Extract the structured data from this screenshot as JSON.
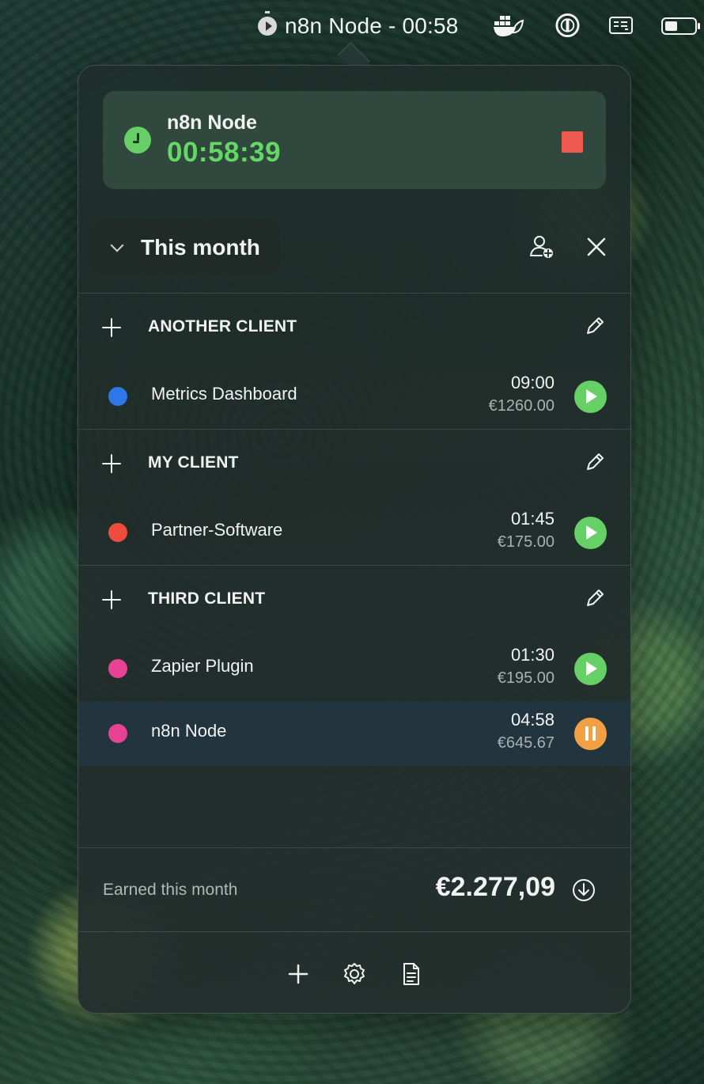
{
  "menubar": {
    "timer_text": "n8n Node - 00:58",
    "icons": [
      "stopwatch-icon",
      "docker-icon",
      "onepassword-icon",
      "keyboard-icon",
      "battery-icon"
    ]
  },
  "active_timer": {
    "project": "n8n Node",
    "elapsed": "00:58:39",
    "status_color": "#66cf65",
    "stop_color": "#ef5a50"
  },
  "filter": {
    "label": "This month"
  },
  "clients": [
    {
      "name": "ANOTHER CLIENT",
      "projects": [
        {
          "name": "Metrics Dashboard",
          "duration": "09:00",
          "earnings": "€1260.00",
          "color": "#2f76ea",
          "state": "play"
        }
      ]
    },
    {
      "name": "MY CLIENT",
      "projects": [
        {
          "name": "Partner-Software",
          "duration": "01:45",
          "earnings": "€175.00",
          "color": "#ef4b3f",
          "state": "play"
        }
      ]
    },
    {
      "name": "THIRD CLIENT",
      "projects": [
        {
          "name": "Zapier Plugin",
          "duration": "01:30",
          "earnings": "€195.00",
          "color": "#e94294",
          "state": "play"
        },
        {
          "name": "n8n Node",
          "duration": "04:58",
          "earnings": "€645.67",
          "color": "#e94294",
          "state": "pause"
        }
      ]
    }
  ],
  "summary": {
    "label": "Earned this month",
    "amount": "€2.277,09"
  },
  "colors": {
    "play": "#66cf65",
    "pause": "#f1a144"
  }
}
